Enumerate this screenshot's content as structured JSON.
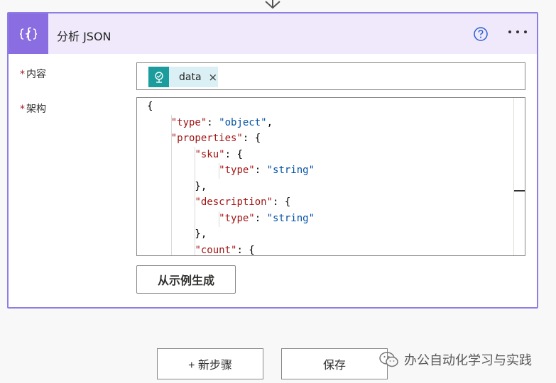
{
  "action": {
    "title": "分析 JSON"
  },
  "fields": {
    "content": {
      "label": "内容",
      "required_mark": "*",
      "token_label": "data",
      "token_close": "×"
    },
    "schema": {
      "label": "架构",
      "required_mark": "*",
      "lines": [
        "{",
        "    \"type\": \"object\",",
        "    \"properties\": {",
        "        \"sku\": {",
        "            \"type\": \"string\"",
        "        },",
        "        \"description\": {",
        "            \"type\": \"string\"",
        "        },",
        "        \"count\": {"
      ]
    },
    "generate_button": "从示例生成"
  },
  "footer": {
    "new_step_button": "+ 新步骤",
    "save_button": "保存"
  },
  "watermark": {
    "text": "办公自动化学习与实践"
  },
  "colors": {
    "accent": "#8a6de0",
    "header_bg": "#efe9fb",
    "card_border": "#8c7ee6",
    "token_bg": "#daf0f5",
    "token_icon": "#1c9c9c",
    "json_key": "#a31515",
    "json_string": "#0451a5",
    "required": "#a4262c"
  },
  "icons": {
    "header": "json-braces-icon",
    "help": "help-circle-icon",
    "more": "more-ellipsis-icon",
    "token": "dynamic-content-icon",
    "flow_arrow": "arrow-down-icon",
    "watermark": "wechat-icon"
  }
}
